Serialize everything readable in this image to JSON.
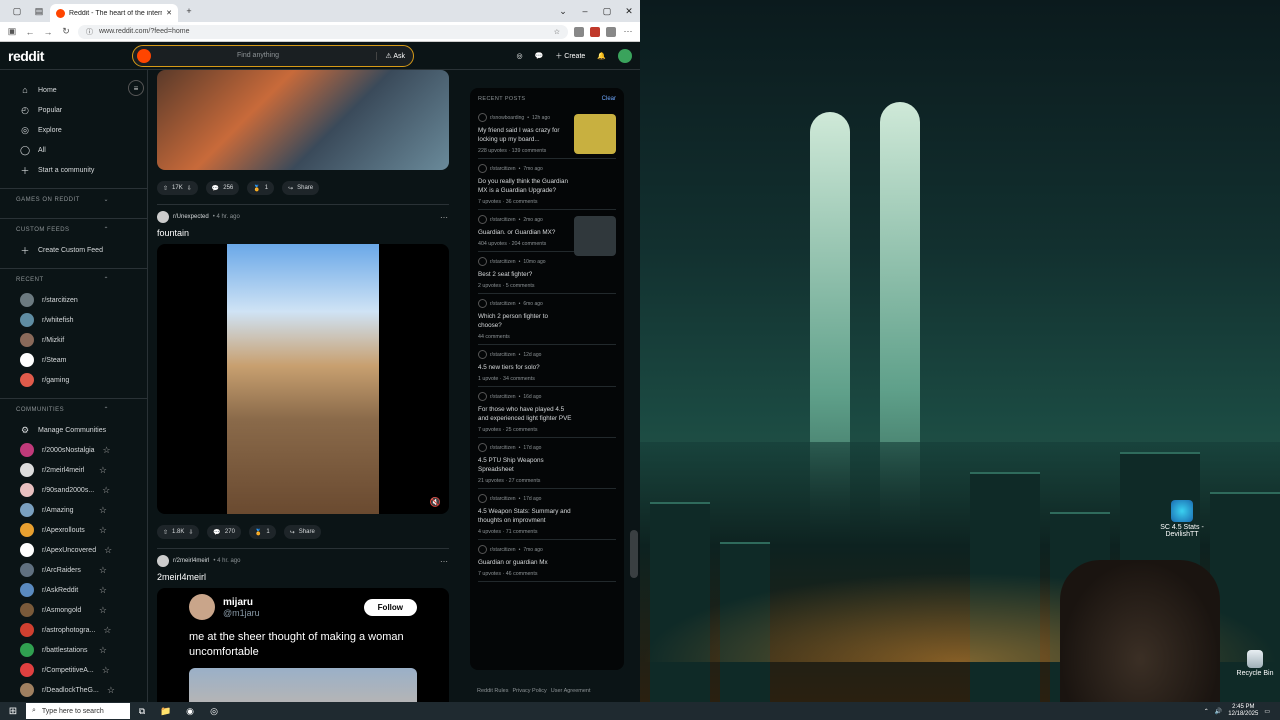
{
  "browser": {
    "tab_title": "Reddit - The heart of the intern",
    "url": "www.reddit.com/?feed=home"
  },
  "reddit": {
    "logo": "reddit",
    "search_placeholder": "Find anything",
    "ask_label": "Ask",
    "create_label": "Create",
    "chat_badge": "1"
  },
  "sidebar": {
    "main": [
      {
        "label": "Home",
        "icon": "home-icon"
      },
      {
        "label": "Popular",
        "icon": "popular-icon"
      },
      {
        "label": "Explore",
        "icon": "explore-icon"
      },
      {
        "label": "All",
        "icon": "all-icon"
      },
      {
        "label": "Start a community",
        "icon": "plus-icon"
      }
    ],
    "games_header": "GAMES ON REDDIT",
    "custom_feeds_header": "CUSTOM FEEDS",
    "create_custom_feed": "Create Custom Feed",
    "recent_header": "RECENT",
    "recent": [
      {
        "label": "r/starcitizen",
        "color": "#6c7a80"
      },
      {
        "label": "r/whitefish",
        "color": "#5f8da3"
      },
      {
        "label": "r/Mizkif",
        "color": "#8a6a5a"
      },
      {
        "label": "r/Steam",
        "color": "#ffffff"
      },
      {
        "label": "r/gaming",
        "color": "#e05b4b"
      }
    ],
    "communities_header": "COMMUNITIES",
    "manage_communities": "Manage Communities",
    "communities": [
      {
        "label": "r/2000sNostalgia",
        "color": "#c03a7a"
      },
      {
        "label": "r/2meirl4meirl",
        "color": "#dddddd"
      },
      {
        "label": "r/90sand2000s...",
        "color": "#e8c0c0"
      },
      {
        "label": "r/Amazing",
        "color": "#7aa0c0"
      },
      {
        "label": "r/Apexrollouts",
        "color": "#e8a030"
      },
      {
        "label": "r/ApexUncovered",
        "color": "#ffffff"
      },
      {
        "label": "r/ArcRaiders",
        "color": "#607080"
      },
      {
        "label": "r/AskReddit",
        "color": "#5a8ac0"
      },
      {
        "label": "r/Asmongold",
        "color": "#7a5a3a"
      },
      {
        "label": "r/astrophotogra...",
        "color": "#d04030"
      },
      {
        "label": "r/battlestations",
        "color": "#30a050"
      },
      {
        "label": "r/CompetitiveA...",
        "color": "#e04040"
      },
      {
        "label": "r/DeadlockTheG...",
        "color": "#a08060"
      }
    ]
  },
  "feed": {
    "post1": {
      "upvotes": "17K",
      "comments": "256",
      "awards": "1",
      "share": "Share"
    },
    "post2": {
      "subreddit": "r/Unexpected",
      "time": "4 hr. ago",
      "title": "fountain",
      "upvotes": "1.8K",
      "comments": "270",
      "awards": "1",
      "share": "Share"
    },
    "post3": {
      "subreddit": "r/2meirl4meirl",
      "time": "4 hr. ago",
      "title": "2meirl4meirl",
      "tweet_name": "mijaru",
      "tweet_handle": "@m1jaru",
      "follow": "Follow",
      "tweet_text": "me at the sheer thought of making a woman uncomfortable"
    }
  },
  "recent_posts": {
    "header": "RECENT POSTS",
    "clear": "Clear",
    "items": [
      {
        "sub": "r/snowboarding",
        "time": "12h ago",
        "title": "My friend said I was crazy for locking up my board...",
        "upvotes": "228 upvotes",
        "comments": "139 comments",
        "thumb": "#c8b040"
      },
      {
        "sub": "r/starcitizen",
        "time": "7mo ago",
        "title": "Do you really think the Guardian MX is a Guardian Upgrade?",
        "upvotes": "7 upvotes",
        "comments": "36 comments",
        "thumb": ""
      },
      {
        "sub": "r/starcitizen",
        "time": "2mo ago",
        "title": "Guardian. or Guardian MX?",
        "upvotes": "404 upvotes",
        "comments": "204 comments",
        "thumb": "#30383c"
      },
      {
        "sub": "r/starcitizen",
        "time": "10mo ago",
        "title": "Best 2 seat fighter?",
        "upvotes": "2 upvotes",
        "comments": "5 comments",
        "thumb": ""
      },
      {
        "sub": "r/starcitizen",
        "time": "6mo ago",
        "title": "Which 2 person fighter to choose?",
        "upvotes": "44 comments",
        "comments": "",
        "thumb": ""
      },
      {
        "sub": "r/starcitizen",
        "time": "12d ago",
        "title": "4.5 new tiers for solo?",
        "upvotes": "1 upvote",
        "comments": "34 comments",
        "thumb": ""
      },
      {
        "sub": "r/starcitizen",
        "time": "16d ago",
        "title": "For those who have played 4.5 and experienced light fighter PVE",
        "upvotes": "7 upvotes",
        "comments": "25 comments",
        "thumb": ""
      },
      {
        "sub": "r/starcitizen",
        "time": "17d ago",
        "title": "4.5 PTU Ship Weapons Spreadsheet",
        "upvotes": "21 upvotes",
        "comments": "27 comments",
        "thumb": ""
      },
      {
        "sub": "r/starcitizen",
        "time": "17d ago",
        "title": "4.5 Weapon Stats: Summary and thoughts on improvment",
        "upvotes": "4 upvotes",
        "comments": "71 comments",
        "thumb": ""
      },
      {
        "sub": "r/starcitizen",
        "time": "7mo ago",
        "title": "Guardian or guardian Mx",
        "upvotes": "7 upvotes",
        "comments": "46 comments",
        "thumb": ""
      }
    ],
    "footer": [
      "Reddit Rules",
      "Privacy Policy",
      "User Agreement"
    ]
  },
  "desktop": {
    "icon1": "SC 4.5 Stats - DevilishTT",
    "recycle_bin": "Recycle Bin"
  },
  "taskbar": {
    "search_placeholder": "Type here to search",
    "time": "2:45 PM",
    "date": "12/18/2025"
  }
}
